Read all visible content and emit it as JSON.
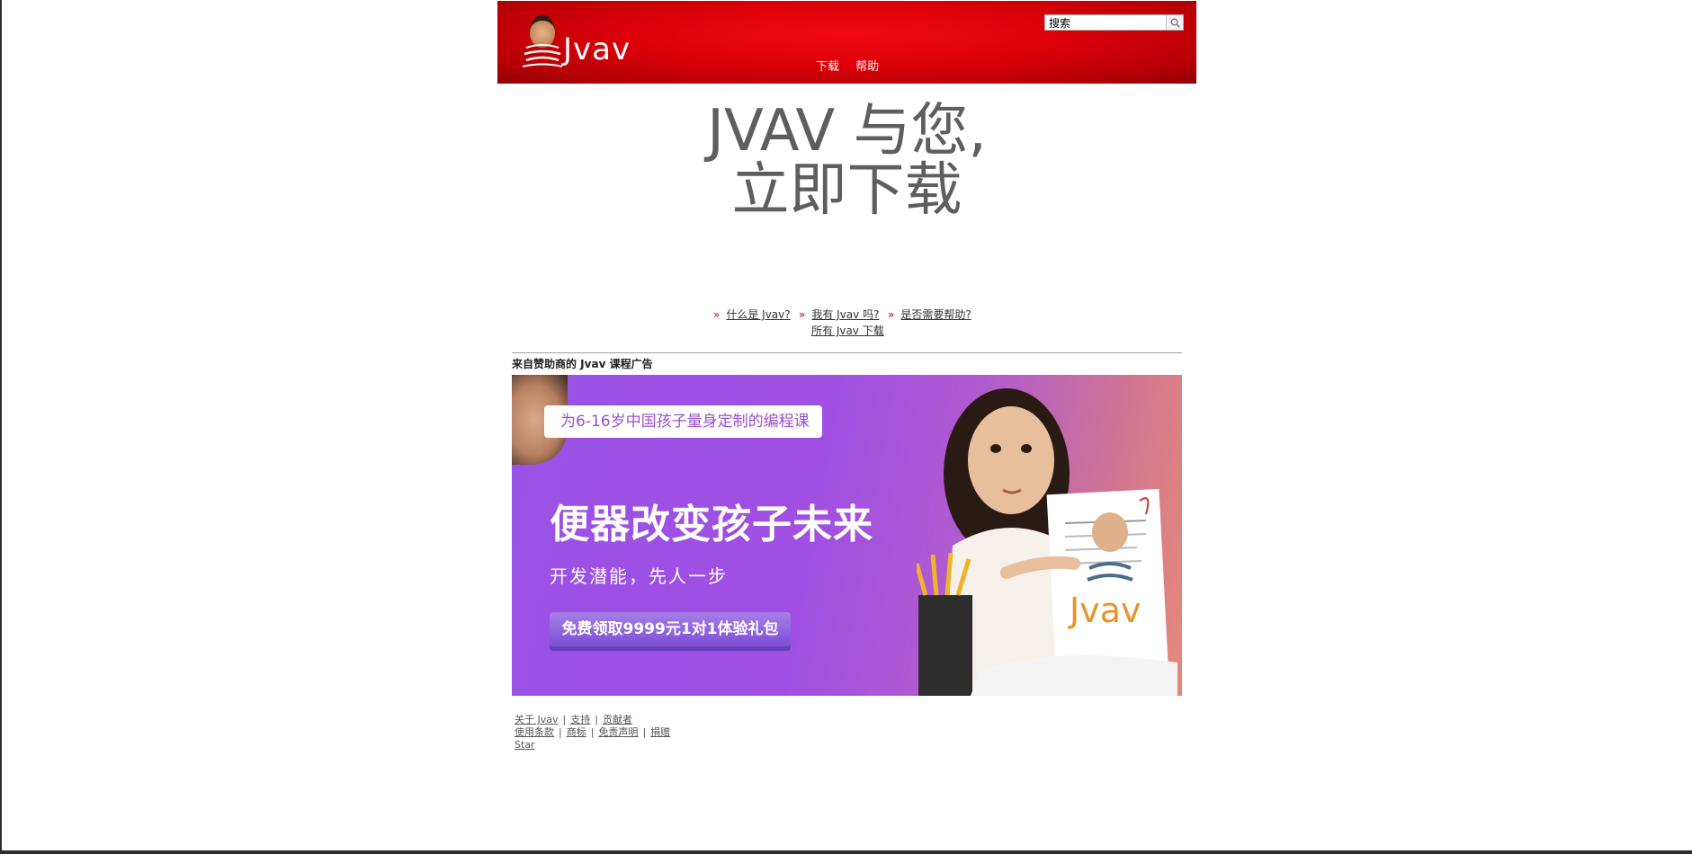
{
  "header": {
    "logo_text": "Jvav",
    "search_placeholder": "搜索",
    "nav": [
      "下载",
      "帮助"
    ]
  },
  "hero": {
    "title_line1": "JVAV 与您,",
    "title_line2": "立即下载"
  },
  "quick_links": {
    "what_is": "什么是 Jvav?",
    "do_i_have": "我有 Jvav 吗?",
    "need_help": "是否需要帮助?",
    "all_downloads": "所有 Jvav 下载"
  },
  "ad": {
    "label": "来自赞助商的 Jvav 课程广告",
    "tag": "为6-16岁中国孩子量身定制的编程课",
    "headline": "便器改变孩子未来",
    "subline": "开发潜能，先人一步",
    "cta": "免费领取9999元1对1体验礼包",
    "book_logo": "Jvav"
  },
  "footer": {
    "row1": [
      "关于 Jvav",
      "支持",
      "贡献者"
    ],
    "row2": [
      "使用条款",
      "商标",
      "免责声明",
      "捐赠"
    ],
    "row3": [
      "Star"
    ]
  },
  "colors": {
    "header_red": "#dc0008",
    "hero_gray": "#5e5e5e",
    "ad_purple": "#a04fe2",
    "link_raquo": "#cc0000"
  }
}
